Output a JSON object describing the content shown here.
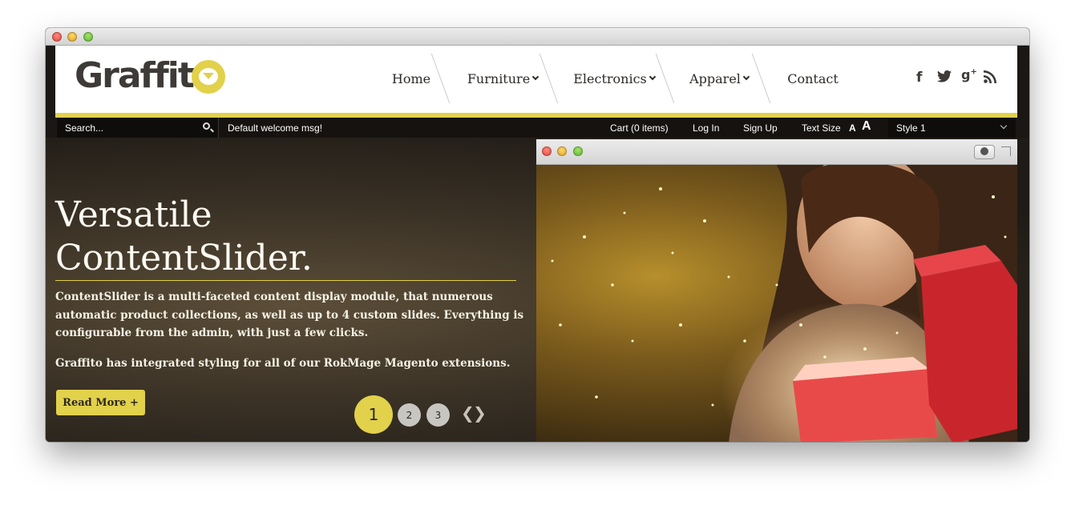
{
  "brand": {
    "logo_text": "Graffit"
  },
  "nav": [
    {
      "label": "Home",
      "has_dropdown": false
    },
    {
      "label": "Furniture",
      "has_dropdown": true
    },
    {
      "label": "Electronics",
      "has_dropdown": true
    },
    {
      "label": "Apparel",
      "has_dropdown": true
    },
    {
      "label": "Contact",
      "has_dropdown": false
    }
  ],
  "social": {
    "facebook": "f",
    "twitter": "t",
    "googleplus": "g+",
    "rss": "rss"
  },
  "topbar": {
    "search_placeholder": "Search...",
    "welcome": "Default welcome msg!",
    "cart": "Cart (0 items)",
    "login": "Log In",
    "signup": "Sign Up",
    "text_size_label": "Text Size",
    "text_small": "A",
    "text_large": "A",
    "style_value": "Style 1"
  },
  "hero": {
    "title_line1": "Versatile",
    "title_line2": "ContentSlider.",
    "paragraph1": "ContentSlider is a multi-faceted content display module, that numerous automatic product collections, as well as up to 4 custom slides. Everything is configurable from the admin, with just a few clicks.",
    "paragraph2": "Graffito has integrated styling for all of our RokMage Magento extensions.",
    "read_more": "Read More +",
    "pager": [
      "1",
      "2",
      "3"
    ],
    "active_page": "1",
    "prev_arrow": "❮",
    "next_arrow": "❯"
  },
  "colors": {
    "accent": "#e2d14a",
    "dark": "#1a1714",
    "text_light": "#fbf9f2"
  }
}
